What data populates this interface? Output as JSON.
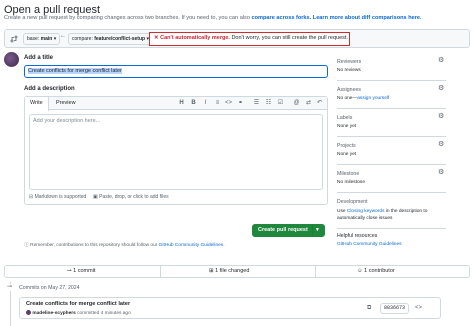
{
  "header": {
    "title": "Open a pull request",
    "subtitle_prefix": "Create a new pull request by comparing changes across two branches. If you need to, you can also ",
    "compare_forks_link": "compare across forks.",
    "learn_more_link": "Learn more about diff comparisons here."
  },
  "compare": {
    "base_label": "base: ",
    "base_value": "main",
    "compare_label": "compare: ",
    "compare_value": "feature/conflict-setup",
    "warning_strong": "Can't automatically merge.",
    "warning_rest": " Don't worry, you can still create the pull request."
  },
  "form": {
    "title_label": "Add a title",
    "title_value": "Create conflicts for merge conflict later",
    "description_label": "Add a description",
    "tabs": [
      "Write",
      "Preview"
    ],
    "description_placeholder": "Add your description here...",
    "markdown_note": "Markdown is supported",
    "attach_note": "Paste, drop, or click to add files",
    "create_button": "Create pull request",
    "remember_prefix": "Remember, contributions to this repository should follow our ",
    "guidelines_link": "GitHub Community Guidelines",
    "remember_suffix": "."
  },
  "sidebar": {
    "reviewers_title": "Reviewers",
    "reviewers_value": "No reviews",
    "assignees_title": "Assignees",
    "assignees_value": "No one—",
    "assign_yourself": "assign yourself",
    "labels_title": "Labels",
    "labels_value": "None yet",
    "projects_title": "Projects",
    "projects_value": "None yet",
    "milestone_title": "Milestone",
    "milestone_value": "No milestone",
    "development_title": "Development",
    "development_prefix": "Use ",
    "closing_keywords_link": "Closing keywords",
    "development_suffix": " in the description to automatically close issues",
    "helpful_title": "Helpful resources",
    "helpful_link": "GitHub Community Guidelines"
  },
  "stats": {
    "commits": "1 commit",
    "files": "1 file changed",
    "contributors": "1 contributor"
  },
  "commits": {
    "date_header": "Commits on May 27, 2024",
    "message": "Create conflicts for merge conflict later",
    "author": "madeline-scyphers",
    "meta": " committed 4 minutes ago",
    "sha": "8836673"
  },
  "colors": {
    "accent": "#0969da",
    "success": "#1f883d",
    "danger": "#d1242f",
    "highlight_border": "#d12b2b"
  }
}
